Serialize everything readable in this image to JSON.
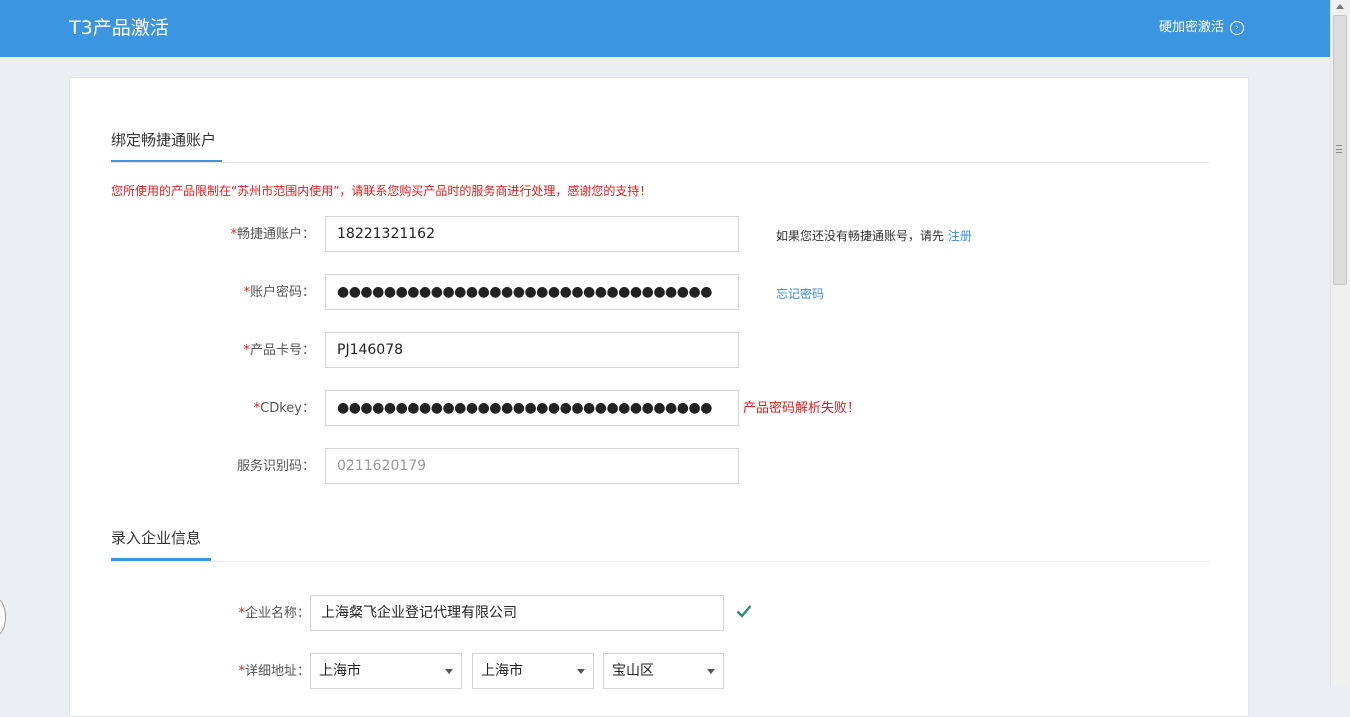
{
  "header": {
    "title": "T3产品激活",
    "hw_activation_label": "硬加密激活"
  },
  "section1": {
    "title": "绑定畅捷通账户",
    "notice": "您所使用的产品限制在“苏州市范围内使用”，请联系您购买产品时的服务商进行处理，感谢您的支持！",
    "fields": {
      "account": {
        "label": "畅捷通账户：",
        "value": "18221321162"
      },
      "password": {
        "label": "账户密码：",
        "value": "●●●●●●●●●●●●●●●●●●●●●●●●●●●●●●●●"
      },
      "card_no": {
        "label": "产品卡号：",
        "value": "PJ146078"
      },
      "cdkey": {
        "label": "CDkey：",
        "value": "●●●●●●●●●●●●●●●●●●●●●●●●●●●●●●●●",
        "error": "产品密码解析失败！"
      },
      "service_code": {
        "label": "服务识别码：",
        "value": "0211620179"
      }
    },
    "register_hint": "如果您还没有畅捷通账号，请先",
    "register_link": "注册",
    "forgot_password": "忘记密码"
  },
  "section2": {
    "title": "录入企业信息",
    "company": {
      "label": "企业名称：",
      "value": "上海粲飞企业登记代理有限公司"
    },
    "address": {
      "label": "详细地址：",
      "province": "上海市",
      "city": "上海市",
      "district": "宝山区"
    }
  },
  "required_mark": "*",
  "colors": {
    "accent": "#3b95e0",
    "error": "#e41c1c",
    "check": "#2e8a7a"
  }
}
